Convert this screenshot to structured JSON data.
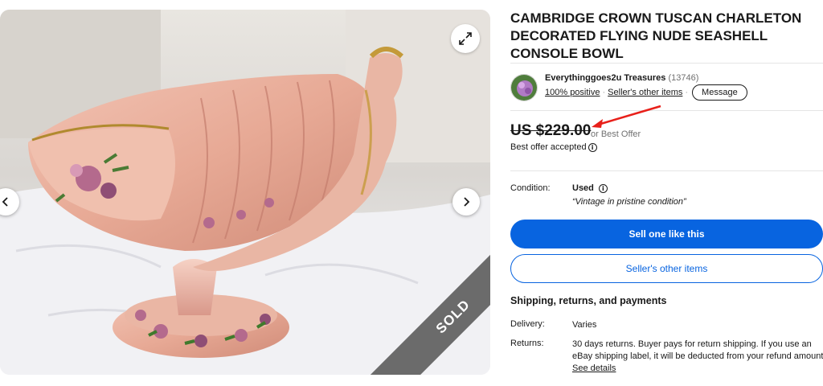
{
  "gallery": {
    "sold_label": "SOLD",
    "icons": {
      "prev": "chevron-left-icon",
      "next": "chevron-right-icon",
      "expand": "expand-icon"
    }
  },
  "item": {
    "title": "CAMBRIDGE CROWN TUSCAN CHARLETON DECORATED FLYING NUDE SEASHELL CONSOLE BOWL"
  },
  "seller": {
    "name": "Everythinggoes2u Treasures",
    "feedback_count": "(13746)",
    "positive": "100% positive",
    "other_items_link": "Seller's other items",
    "message_button": "Message"
  },
  "pricing": {
    "price": "US $229.00",
    "best_offer": "or Best Offer",
    "offer_accepted": "Best offer accepted",
    "annotation_arrow_color": "#e8201a"
  },
  "condition": {
    "label": "Condition:",
    "value": "Used",
    "description": "“Vintage in pristine condition”"
  },
  "actions": {
    "sell_one_like_this": "Sell one like this",
    "sellers_other_items": "Seller's other items"
  },
  "shipping": {
    "title": "Shipping, returns, and payments",
    "delivery_label": "Delivery:",
    "delivery_value": "Varies",
    "returns_label": "Returns:",
    "returns_value": "30 days returns. Buyer pays for return shipping. If you use an eBay shipping label, it will be deducted from your refund amount.",
    "see_details": "See details"
  },
  "colors": {
    "primary_blue": "#0864e0",
    "text": "#191919",
    "muted": "#707070"
  }
}
